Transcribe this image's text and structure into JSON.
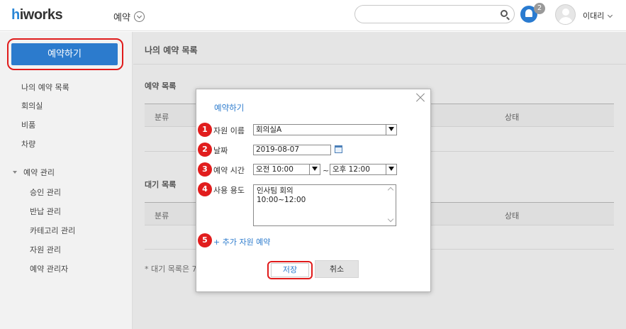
{
  "topbar": {
    "logo_h": "h",
    "logo_rest": "iworks",
    "app_title": "예약",
    "notification_count": "2",
    "user_name": "이대리"
  },
  "sidebar": {
    "reserve_button": "예약하기",
    "items": [
      "나의 예약 목록",
      "회의실",
      "비품",
      "차량"
    ],
    "manage_group": "예약 관리",
    "manage_items": [
      "승인 관리",
      "반납 관리",
      "카테고리 관리",
      "자원 관리",
      "예약 관리자"
    ]
  },
  "main": {
    "title": "나의 예약 목록",
    "reservation_section": "예약 목록",
    "waiting_section": "대기 목록",
    "col_category": "분류",
    "col_status": "상태",
    "footnote": "* 대기 목록은 7"
  },
  "modal": {
    "title": "예약하기",
    "resource_label": "자원 이름",
    "resource_value": "회의실A",
    "date_label": "날짜",
    "date_value": "2019-08-07",
    "time_label": "예약 시간",
    "time_start": "오전 10:00",
    "time_sep": "~",
    "time_end": "오후 12:00",
    "purpose_label": "사용 용도",
    "purpose_line1": "인사팀 회의",
    "purpose_line2": "10:00~12:00",
    "add_link": "+ 추가 자원 예약",
    "save_button": "저장",
    "cancel_button": "취소",
    "step_numbers": [
      "1",
      "2",
      "3",
      "4",
      "5"
    ]
  },
  "colors": {
    "accent": "#2c7bcd",
    "highlight": "#e01b1b",
    "badge": "#999999"
  }
}
